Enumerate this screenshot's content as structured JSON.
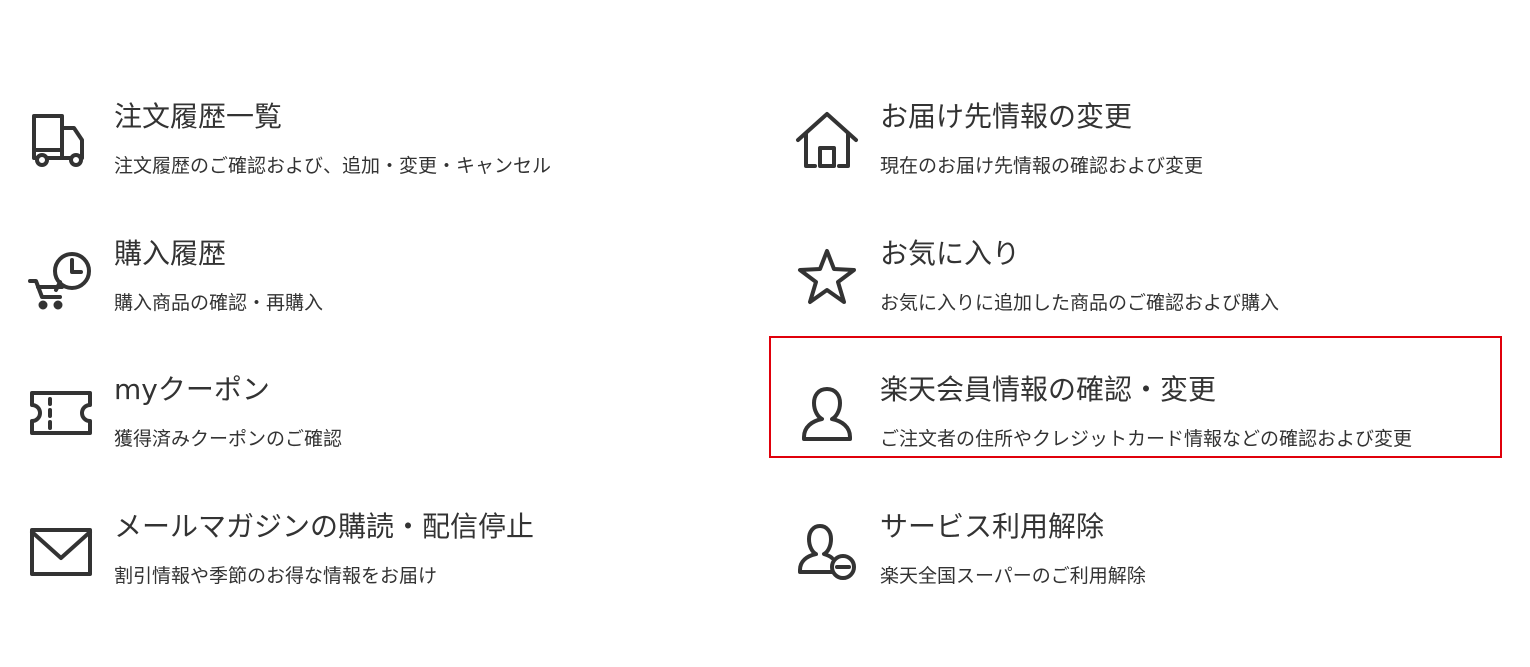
{
  "menu": {
    "items": [
      {
        "icon": "truck-icon",
        "title": "注文履歴一覧",
        "description": "注文履歴のご確認および、追加・変更・キャンセル"
      },
      {
        "icon": "house-icon",
        "title": "お届け先情報の変更",
        "description": "現在のお届け先情報の確認および変更"
      },
      {
        "icon": "cart-clock-icon",
        "title": "購入履歴",
        "description": "購入商品の確認・再購入"
      },
      {
        "icon": "star-icon",
        "title": "お気に入り",
        "description": "お気に入りに追加した商品のご確認および購入"
      },
      {
        "icon": "coupon-icon",
        "title": "myクーポン",
        "description": "獲得済みクーポンのご確認"
      },
      {
        "icon": "user-icon",
        "title": "楽天会員情報の確認・変更",
        "description": "ご注文者の住所やクレジットカード情報などの確認および変更"
      },
      {
        "icon": "envelope-icon",
        "title": "メールマガジンの購読・配信停止",
        "description": "割引情報や季節のお得な情報をお届け"
      },
      {
        "icon": "user-minus-icon",
        "title": "サービス利用解除",
        "description": "楽天全国スーパーのご利用解除"
      }
    ],
    "highlighted_index": 5
  },
  "colors": {
    "text": "#333333",
    "icon_stroke": "#333333",
    "highlight_border": "#e0000b",
    "background": "#ffffff"
  }
}
